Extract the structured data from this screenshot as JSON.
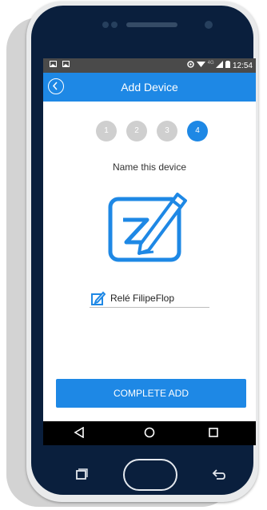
{
  "statusbar": {
    "left_icons": [
      "image-icon",
      "image-icon"
    ],
    "network": "4G",
    "time": "12:54"
  },
  "appbar": {
    "title": "Add Device",
    "back_icon": "back-circle-icon"
  },
  "steps": [
    {
      "label": "1",
      "active": false
    },
    {
      "label": "2",
      "active": false
    },
    {
      "label": "3",
      "active": false
    },
    {
      "label": "4",
      "active": true
    }
  ],
  "subtitle": "Name this device",
  "illustration_icon": "edit-pen-icon",
  "device_name": {
    "value": "Relé FilipeFlop",
    "icon": "edit-small-icon"
  },
  "complete_button": "COMPLETE ADD",
  "navbar": {
    "items": [
      "back-triangle-icon",
      "home-circle-icon",
      "recents-square-icon"
    ]
  },
  "colors": {
    "accent": "#1e88e5",
    "inactive_step": "#cfcfcf",
    "phone_body": "#0a1f3d"
  }
}
